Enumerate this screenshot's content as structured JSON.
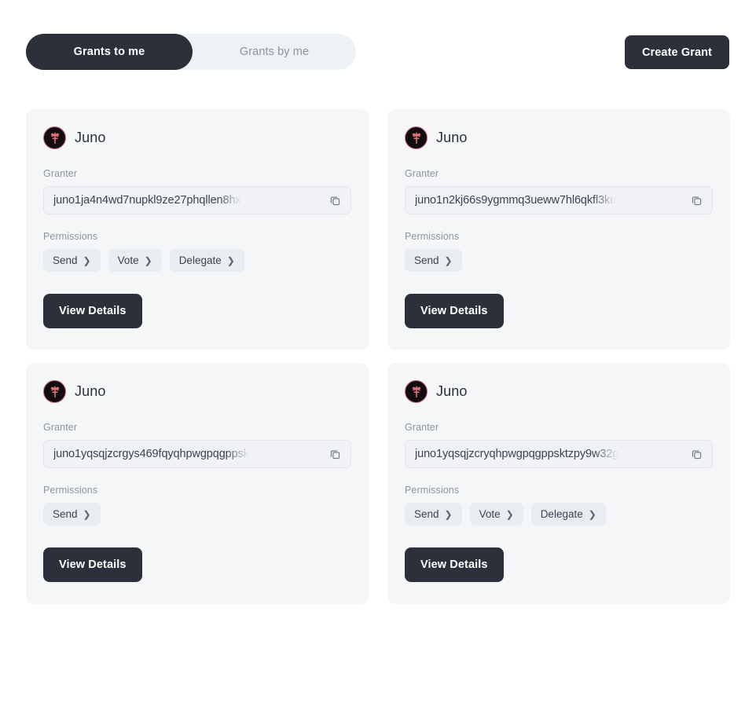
{
  "header": {
    "tabs": [
      {
        "label": "Grants to me",
        "active": true
      },
      {
        "label": "Grants by me",
        "active": false
      }
    ],
    "create_button_label": "Create Grant"
  },
  "labels": {
    "granter": "Granter",
    "permissions": "Permissions",
    "view_details": "View Details",
    "copy_icon": "copy-icon",
    "chain_icon": "juno-logo-icon"
  },
  "theme": {
    "page_bg": "#ffffff",
    "card_bg": "#f4f6f8",
    "dark": "#2b303a",
    "muted_text": "#8d949f",
    "chip_bg": "#e9edf2",
    "accent_logo": "#e8767c"
  },
  "cards": [
    {
      "chain": "Juno",
      "granter_label": "Granter",
      "granter_address": "juno1ja4n4wd7nupkl9ze27phqllen8hx",
      "permissions_label": "Permissions",
      "permissions": [
        "Send",
        "Vote",
        "Delegate"
      ],
      "view_details_label": "View Details"
    },
    {
      "chain": "Juno",
      "granter_label": "Granter",
      "granter_address": "juno1n2kj66s9ygmmq3ueww7hl6qkfl3ku",
      "permissions_label": "Permissions",
      "permissions": [
        "Send"
      ],
      "view_details_label": "View Details"
    },
    {
      "chain": "Juno",
      "granter_label": "Granter",
      "granter_address": "juno1yqsqjzcrgys469fqyqhpwgpqgppsk",
      "permissions_label": "Permissions",
      "permissions": [
        "Send"
      ],
      "view_details_label": "View Details"
    },
    {
      "chain": "Juno",
      "granter_label": "Granter",
      "granter_address": "juno1yqsqjzcryqhpwgpqgppsktzpy9w32g",
      "permissions_label": "Permissions",
      "permissions": [
        "Send",
        "Vote",
        "Delegate"
      ],
      "view_details_label": "View Details"
    }
  ]
}
